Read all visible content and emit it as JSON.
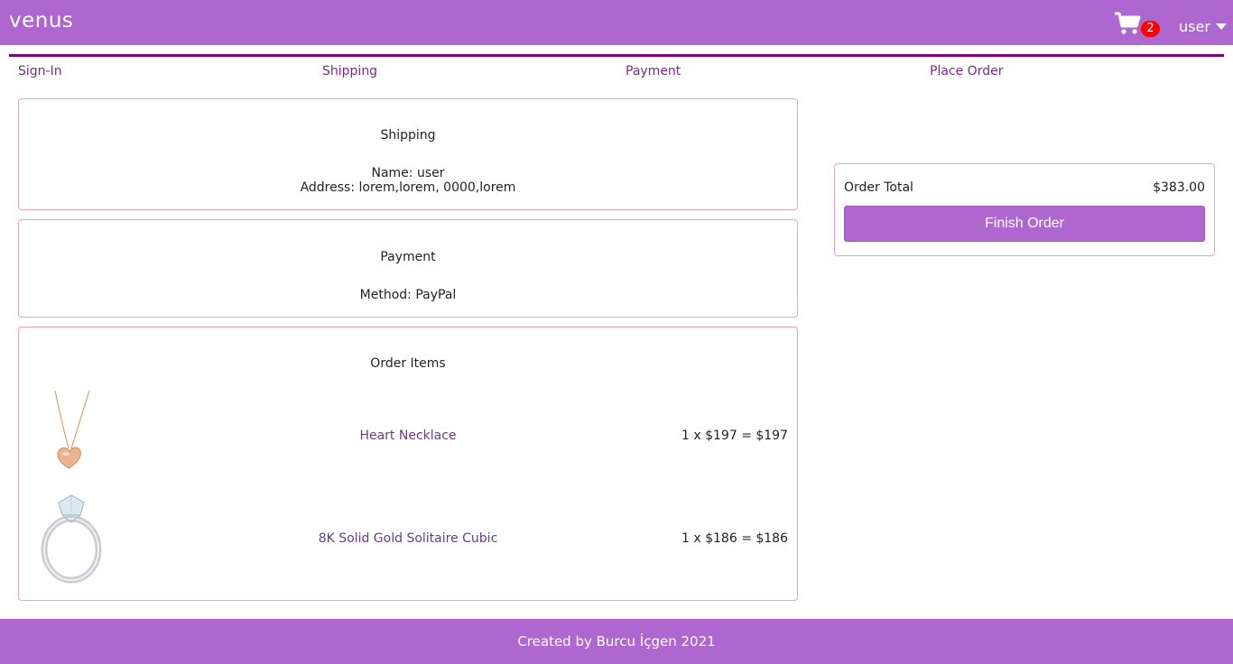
{
  "header": {
    "brand": "venus",
    "cart_count": "2",
    "user_label": "user",
    "accent_color": "#ad67cf"
  },
  "steps": [
    {
      "label": "Sign-In"
    },
    {
      "label": "Shipping"
    },
    {
      "label": "Payment"
    },
    {
      "label": "Place Order"
    }
  ],
  "shipping": {
    "title": "Shipping",
    "name_line": "Name: user",
    "address_line": "Address: lorem,lorem, 0000,lorem"
  },
  "payment": {
    "title": "Payment",
    "method_line": "Method: PayPal"
  },
  "order_items": {
    "title": "Order Items",
    "items": [
      {
        "name": "Heart Necklace",
        "price_line": "1 x $197 = $197",
        "image_icon": "heart-necklace-image"
      },
      {
        "name": "8K Solid Gold Solitaire Cubic",
        "price_line": "1 x $186 = $186",
        "image_icon": "solitaire-ring-image"
      }
    ]
  },
  "summary": {
    "label": "Order Total",
    "value": "$383.00",
    "button_label": "Finish Order"
  },
  "footer": {
    "text": "Created by Burcu İçgen 2021"
  }
}
